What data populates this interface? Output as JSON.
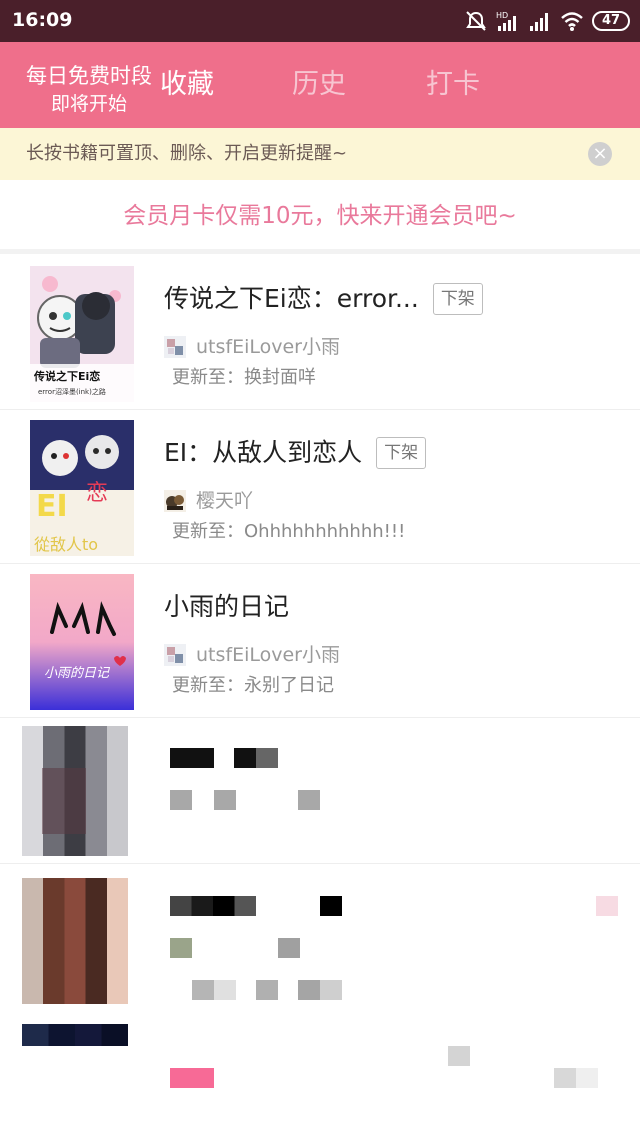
{
  "status_bar": {
    "time": "16:09",
    "battery": "47",
    "icons": [
      "mute-icon",
      "hd-signal-icon",
      "signal-icon",
      "wifi-icon",
      "battery-icon"
    ]
  },
  "header": {
    "free_line1": "每日免费时段",
    "free_line2": "即将开始",
    "tabs": [
      {
        "label": "收藏",
        "active": true
      },
      {
        "label": "历史",
        "active": false
      },
      {
        "label": "打卡",
        "active": false
      }
    ],
    "background": "#ef6f8b"
  },
  "notice": {
    "text": "长按书籍可置顶、删除、开启更新提醒~",
    "close_icon": "close-icon"
  },
  "promo": {
    "text": "会员月卡仅需10元，快来开通会员吧~"
  },
  "books": [
    {
      "title": "传说之下Ei恋：error...",
      "tag": "下架",
      "author": "utsfEiLover小雨",
      "update": "更新至：换封面咩"
    },
    {
      "title": "EI：从敌人到恋人",
      "tag": "下架",
      "author": "樱天吖",
      "update": "更新至：Ohhhhhhhhhhh!!!"
    },
    {
      "title": "小雨的日记",
      "tag": "",
      "author": "utsfEiLover小雨",
      "update": "更新至：永别了日记",
      "cover_text": "小雨的日记"
    }
  ]
}
